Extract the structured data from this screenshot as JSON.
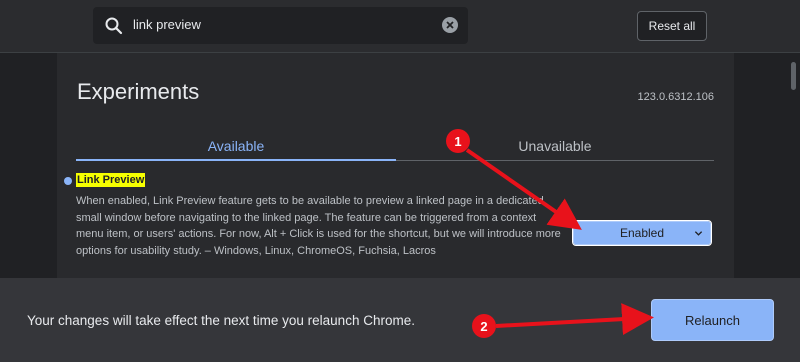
{
  "search": {
    "query": "link preview"
  },
  "toolbar": {
    "reset_label": "Reset all"
  },
  "page": {
    "title": "Experiments",
    "version": "123.0.6312.106",
    "tabs": [
      {
        "label": "Available",
        "active": true
      },
      {
        "label": "Unavailable",
        "active": false
      }
    ]
  },
  "experiment": {
    "name": "Link Preview",
    "description": "When enabled, Link Preview feature gets to be available to preview a linked page in a dedicated small window before navigating to the linked page. The feature can be triggered from a context menu item, or users' actions. For now, Alt + Click is used for the shortcut, but we will introduce more options for usability study. – Windows, Linux, ChromeOS, Fuchsia, Lacros",
    "selected_option": "Enabled"
  },
  "relaunch_bar": {
    "message": "Your changes will take effect the next time you relaunch Chrome.",
    "button_label": "Relaunch"
  },
  "annotations": [
    {
      "number": "1"
    },
    {
      "number": "2"
    }
  ],
  "colors": {
    "accent": "#8ab4f8",
    "highlight": "#f6ff00",
    "annotation": "#e8121b",
    "background": "#202124"
  }
}
